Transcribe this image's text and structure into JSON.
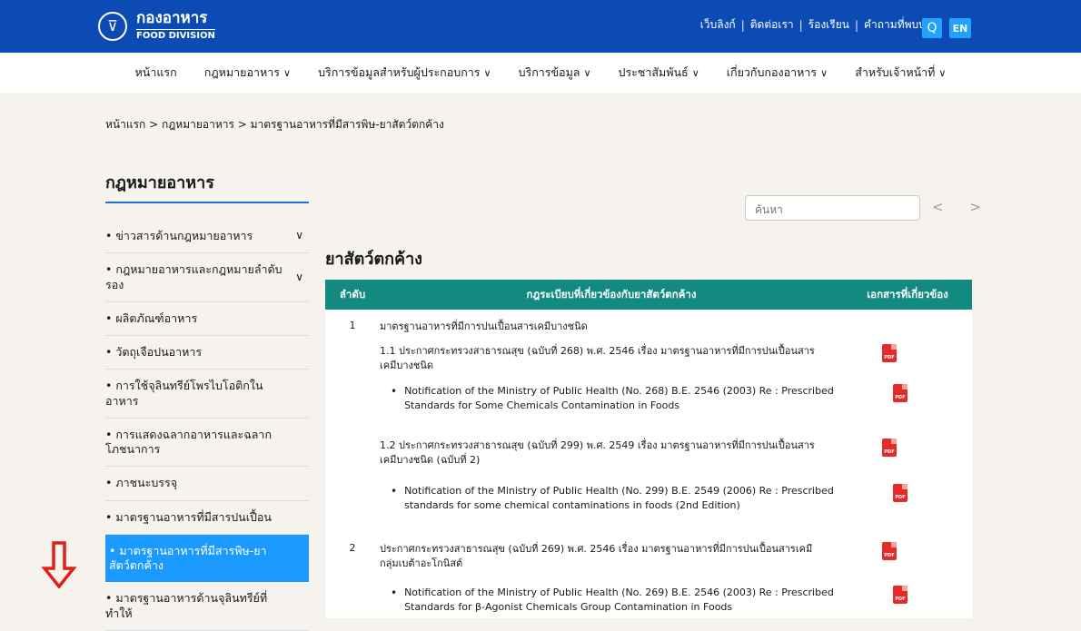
{
  "header": {
    "logo_thai": "กองอาหาร",
    "logo_en": "FOOD DIVISION",
    "links": [
      "เว็บลิงก์",
      "ติดต่อเรา",
      "ร้องเรียน",
      "คำถามที่พบบ่อย"
    ],
    "separator": "|",
    "search_icon": "Q",
    "lang": "EN"
  },
  "nav": {
    "items": [
      {
        "label": "หน้าแรก",
        "has_menu": false
      },
      {
        "label": "กฎหมายอาหาร",
        "has_menu": true
      },
      {
        "label": "บริการข้อมูลสำหรับผู้ประกอบการ",
        "has_menu": true
      },
      {
        "label": "บริการข้อมูล",
        "has_menu": true
      },
      {
        "label": "ประชาสัมพันธ์",
        "has_menu": true
      },
      {
        "label": "เกี่ยวกับกองอาหาร",
        "has_menu": true
      },
      {
        "label": "สำหรับเจ้าหน้าที่",
        "has_menu": true
      }
    ],
    "chevron": "∨"
  },
  "breadcrumb": "หน้าแรก > กฎหมายอาหาร > มาตรฐานอาหารที่มีสารพิษ-ยาสัตว์ตกค้าง",
  "sidebar": {
    "title": "กฎหมายอาหาร",
    "items": [
      {
        "label": "• ข่าวสารด้านกฎหมายอาหาร",
        "chev": "∨"
      },
      {
        "label": "• กฎหมายอาหารและกฎหมายลำดับรอง",
        "chev": "∨"
      },
      {
        "label": "• ผลิตภัณฑ์อาหาร",
        "chev": ""
      },
      {
        "label": "• วัตถุเจือปนอาหาร",
        "chev": ""
      },
      {
        "label": "• การใช้จุลินทรีย์โพรไบโอติกในอาหาร",
        "chev": ""
      },
      {
        "label": "• การแสดงฉลากอาหารและฉลากโภชนาการ",
        "chev": ""
      },
      {
        "label": "• ภาชนะบรรจุ",
        "chev": ""
      },
      {
        "label": "• มาตรฐานอาหารที่มีสารปนเปื้อน",
        "chev": ""
      },
      {
        "label": "• มาตรฐานอาหารที่มีสารพิษ-ยาสัตว์ตกค้าง",
        "chev": ""
      },
      {
        "label": "• มาตรฐานอาหารด้านจุลินทรีย์ที่ทำให้",
        "chev": ""
      }
    ]
  },
  "content": {
    "search_placeholder": "ค้นหา",
    "pager": "< >",
    "title": "ยาสัตว์ตกค้าง",
    "table": {
      "headers": [
        "ลำดับ",
        "กฎระเบียบที่เกี่ยวข้องกับยาสัตว์ตกค้าง",
        "เอกสารที่เกี่ยวข้อง"
      ],
      "rows": [
        {
          "num": "1",
          "text": "มาตรฐานอาหารที่มีการปนเปื้อนสารเคมีบางชนิด"
        },
        {
          "num": "",
          "text": "1.1 ประกาศกระทรวงสาธารณสุข (ฉบับที่ 268) พ.ศ. 2546 เรื่อง มาตรฐานอาหารที่มีการปนเปื้อนสารเคมีบางชนิด",
          "pdf": "PDF"
        },
        {
          "num": "",
          "text": "Notification of the Ministry of Public Health (No. 268) B.E. 2546 (2003) Re : Prescribed Standards for Some Chemicals Contamination in Foods",
          "pdf": "PDF",
          "bullet": "•"
        },
        {
          "num": "",
          "text": "1.2 ประกาศกระทรวงสาธารณสุข (ฉบับที่ 299) พ.ศ. 2549 เรื่อง มาตรฐานอาหารที่มีการปนเปื้อนสารเคมีบางชนิด (ฉบับที่ 2)",
          "pdf": "PDF"
        },
        {
          "num": "",
          "text": "Notification of the Ministry of Public Health (No. 299) B.E. 2549 (2006) Re : Prescribed standards for some chemical contaminations in foods (2nd Edition)",
          "pdf": "PDF",
          "bullet": "•"
        },
        {
          "num": "2",
          "text": "ประกาศกระทรวงสาธารณสุข (ฉบับที่ 269) พ.ศ. 2546 เรื่อง มาตรฐานอาหารที่มีการปนเปื้อนสารเคมีกลุ่มเบต้าอะโกนิสต์",
          "pdf": "PDF"
        },
        {
          "num": "",
          "text": "Notification of the Ministry of Public Health (No. 269) B.E. 2546 (2003) Re : Prescribed Standards for β-Agonist Chemicals Group Contamination in Foods",
          "pdf": "PDF",
          "bullet": "•"
        }
      ]
    }
  },
  "colors": {
    "primary": "#0b4bb3",
    "teal": "#138a80",
    "active": "#1a9aff",
    "arrow": "#e0201b"
  },
  "icons": {
    "arrow": "down-arrow-icon",
    "pdf": "pdf-icon",
    "search": "search-icon"
  }
}
